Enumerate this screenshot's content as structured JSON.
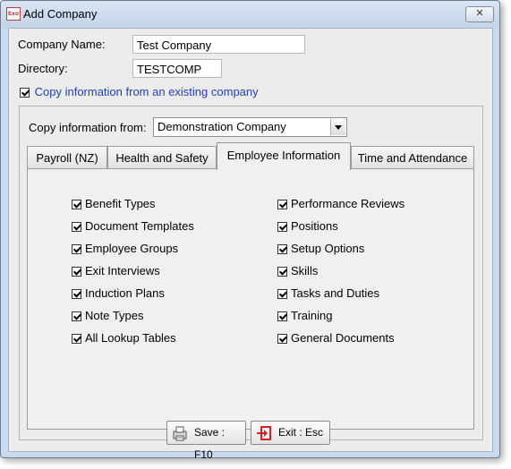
{
  "window": {
    "title": "Add Company",
    "app_icon_text": "Exo",
    "close_symbol": "✕"
  },
  "form": {
    "company_name_label": "Company Name:",
    "company_name_value": "Test Company",
    "directory_label": "Directory:",
    "directory_value": "TESTCOMP",
    "copy_checkbox_label": "Copy information from an existing company",
    "copy_checkbox_checked": true,
    "copy_from_label": "Copy information from:",
    "copy_from_value": "Demonstration Company"
  },
  "tabs": [
    {
      "label": "Payroll (NZ)",
      "active": false
    },
    {
      "label": "Health and Safety",
      "active": false
    },
    {
      "label": "Employee Information",
      "active": true
    },
    {
      "label": "Time and Attendance",
      "active": false
    }
  ],
  "options": {
    "left": [
      {
        "label": "Benefit Types",
        "checked": true
      },
      {
        "label": "Document Templates",
        "checked": true
      },
      {
        "label": "Employee Groups",
        "checked": true
      },
      {
        "label": "Exit Interviews",
        "checked": true
      },
      {
        "label": "Induction Plans",
        "checked": true
      },
      {
        "label": "Note Types",
        "checked": true
      },
      {
        "label": "All Lookup Tables",
        "checked": true
      }
    ],
    "right": [
      {
        "label": "Performance Reviews",
        "checked": true
      },
      {
        "label": "Positions",
        "checked": true
      },
      {
        "label": "Setup Options",
        "checked": true
      },
      {
        "label": "Skills",
        "checked": true
      },
      {
        "label": "Tasks and Duties",
        "checked": true
      },
      {
        "label": "Training",
        "checked": true
      },
      {
        "label": "General Documents",
        "checked": true
      }
    ]
  },
  "buttons": {
    "save_label": "Save : F10",
    "save_icon": "save-printer-icon",
    "exit_label": "Exit : Esc",
    "exit_icon": "exit-door-icon"
  },
  "colors": {
    "link_blue": "#1f3fbf",
    "exit_red": "#d42020",
    "titlebar": "#c9d9ee"
  }
}
